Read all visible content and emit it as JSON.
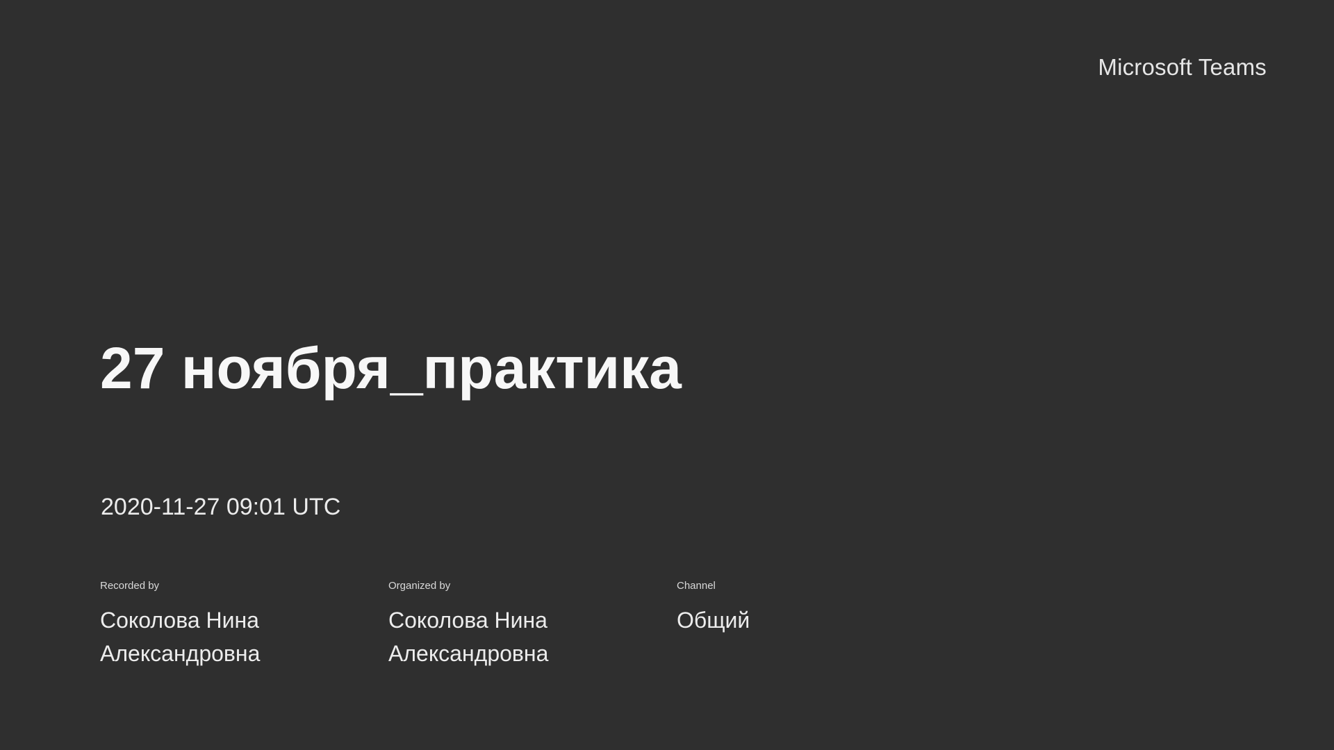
{
  "app": {
    "brand": "Microsoft Teams"
  },
  "recording": {
    "title": "27 ноября_практика",
    "datetime": "2020-11-27 09:01 UTC"
  },
  "details": [
    {
      "label": "Recorded by",
      "value": "Соколова Нина Александровна"
    },
    {
      "label": "Organized by",
      "value": "Соколова Нина Александровна"
    },
    {
      "label": "Channel",
      "value": "Общий"
    }
  ],
  "colors": {
    "background": "#2f2f2f",
    "text": "#f2f2f2"
  }
}
